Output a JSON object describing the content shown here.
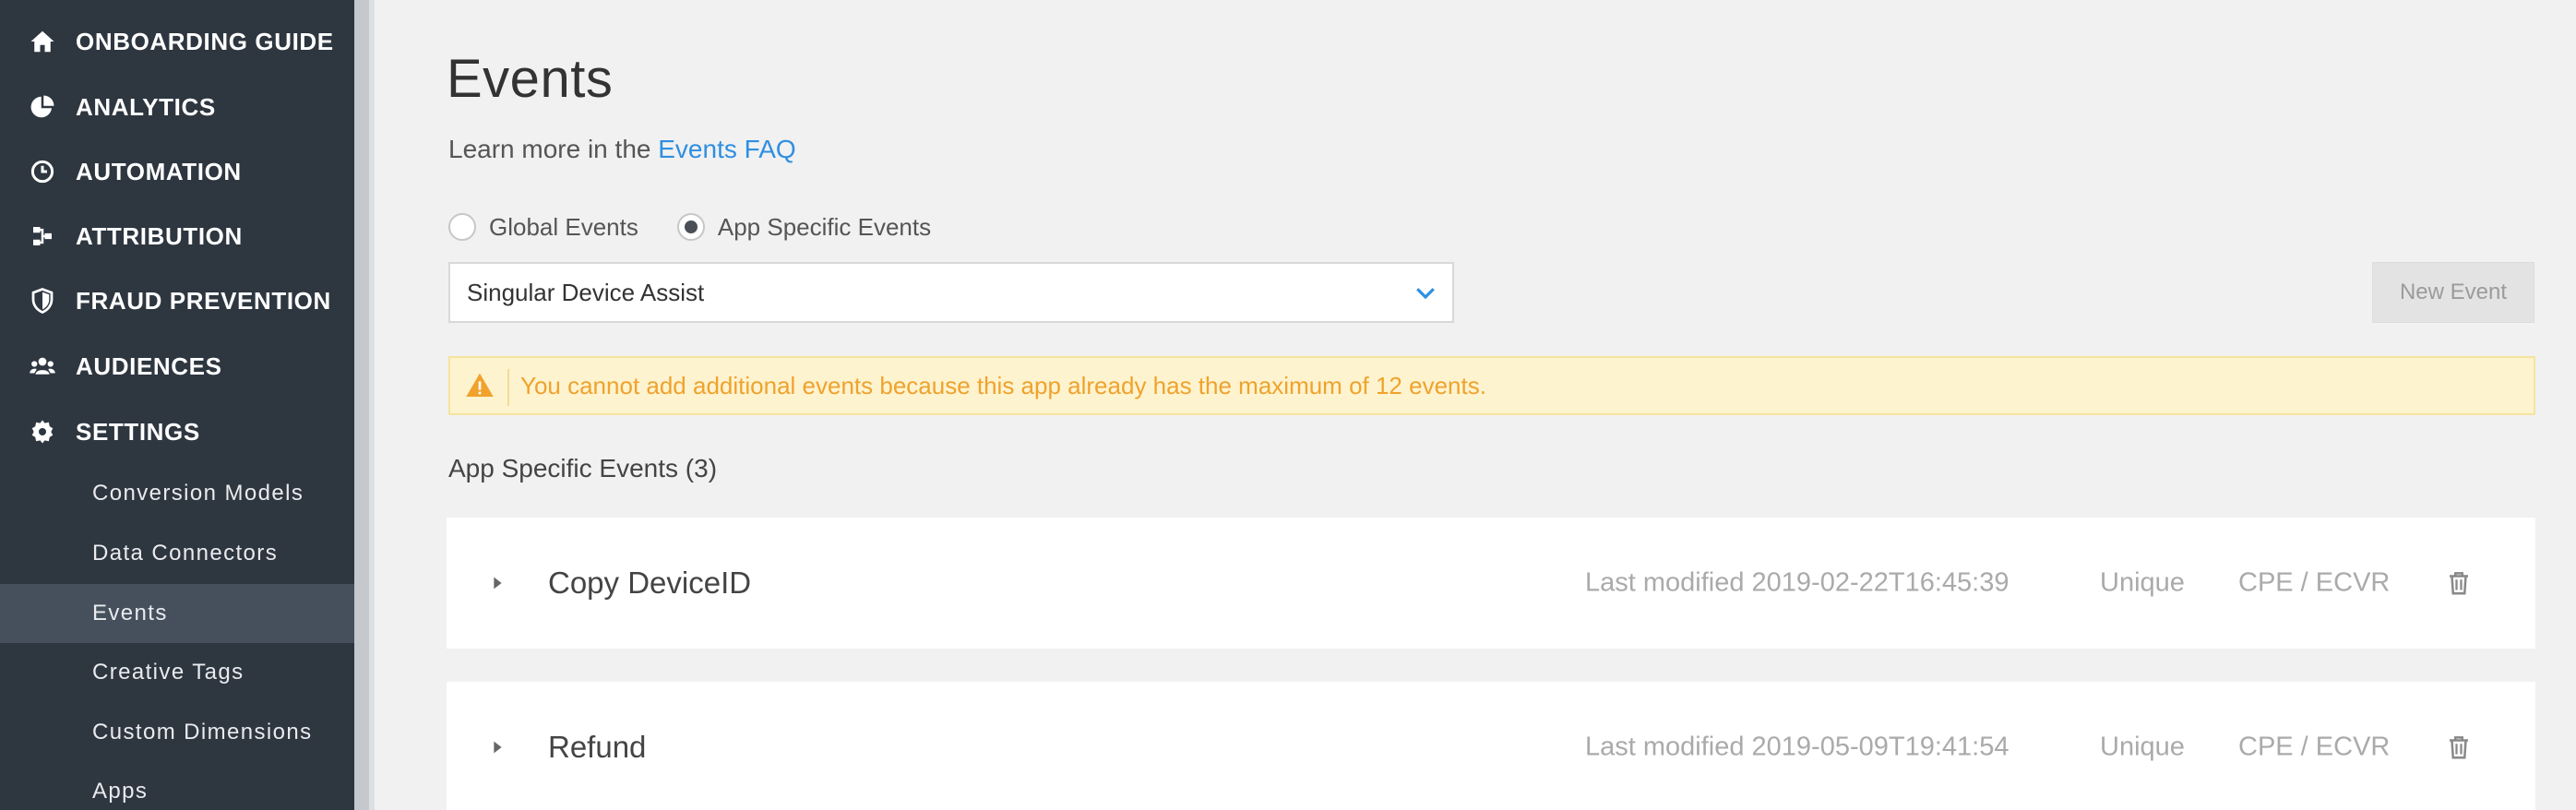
{
  "sidebar": {
    "items": [
      {
        "label": "ONBOARDING GUIDE",
        "icon": "home-icon"
      },
      {
        "label": "ANALYTICS",
        "icon": "pie-chart-icon"
      },
      {
        "label": "AUTOMATION",
        "icon": "clock-icon"
      },
      {
        "label": "ATTRIBUTION",
        "icon": "attribution-icon"
      },
      {
        "label": "FRAUD PREVENTION",
        "icon": "shield-icon"
      },
      {
        "label": "AUDIENCES",
        "icon": "users-icon"
      },
      {
        "label": "SETTINGS",
        "icon": "gear-icon"
      }
    ],
    "settings_subitems": [
      {
        "label": "Conversion Models",
        "active": false
      },
      {
        "label": "Data Connectors",
        "active": false
      },
      {
        "label": "Events",
        "active": true
      },
      {
        "label": "Creative Tags",
        "active": false
      },
      {
        "label": "Custom Dimensions",
        "active": false
      },
      {
        "label": "Apps",
        "active": false
      }
    ]
  },
  "main": {
    "title": "Events",
    "learn_more_prefix": "Learn more in the ",
    "learn_more_link": "Events FAQ",
    "radios": [
      {
        "label": "Global Events",
        "checked": false
      },
      {
        "label": "App Specific Events",
        "checked": true
      }
    ],
    "app_select": {
      "value": "Singular Device Assist"
    },
    "new_event_button": "New Event",
    "alert": "You cannot add additional events because this app already has the maximum of 12 events.",
    "section_title": "App Specific Events (3)",
    "events": [
      {
        "name": "Copy DeviceID",
        "modified": "Last modified 2019-02-22T16:45:39",
        "uniqueness": "Unique",
        "model": "CPE / ECVR"
      },
      {
        "name": "Refund",
        "modified": "Last modified 2019-05-09T19:41:54",
        "uniqueness": "Unique",
        "model": "CPE / ECVR"
      }
    ]
  },
  "colors": {
    "sidebar_bg": "#2e3640",
    "sidebar_active": "#46505c",
    "link": "#2f8fe0",
    "alert_bg": "#fdf3cf",
    "alert_text": "#f0a22c"
  }
}
